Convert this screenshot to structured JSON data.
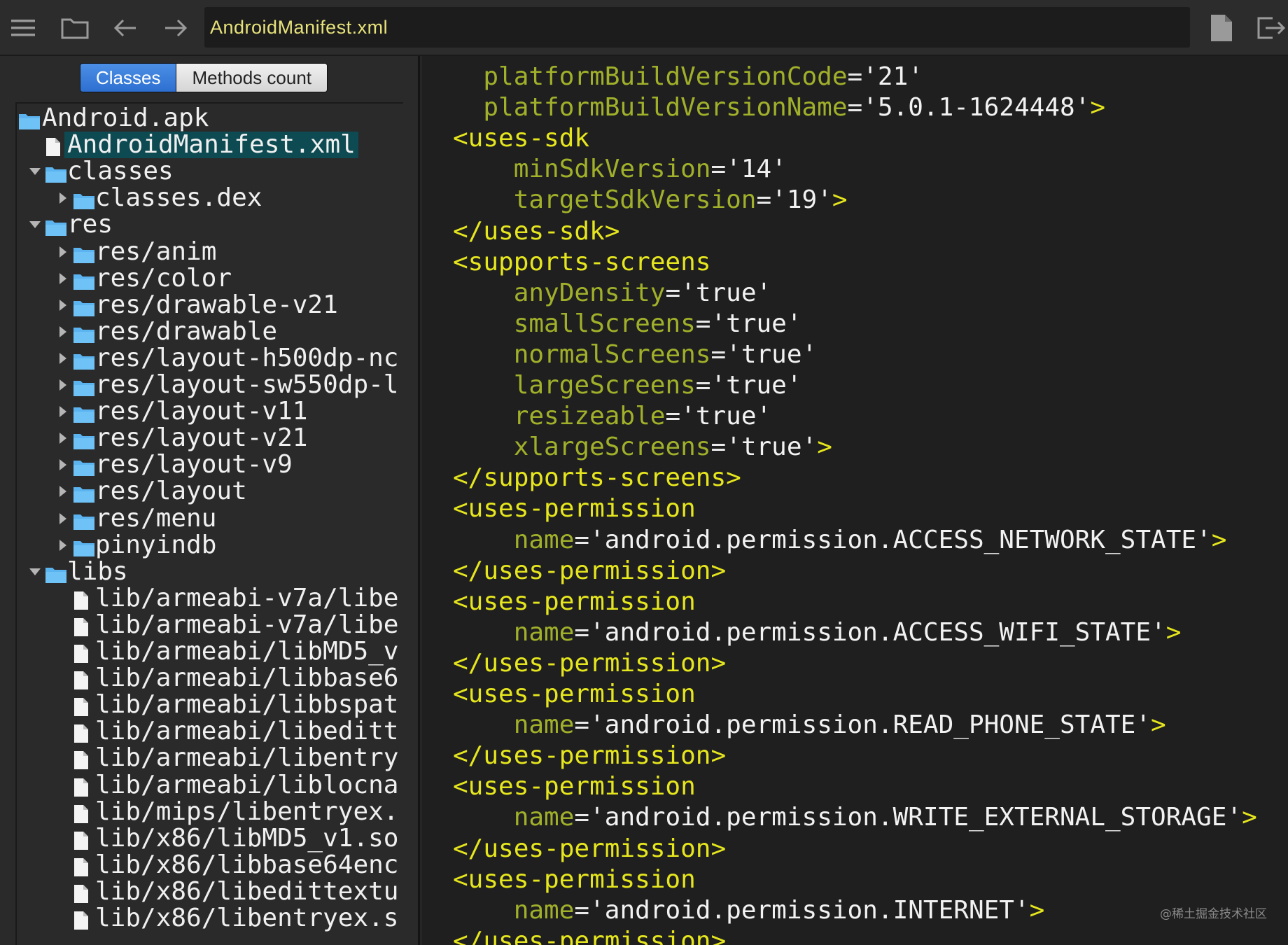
{
  "toolbar": {
    "icons": [
      "menu-icon",
      "folder-icon",
      "back-arrow-icon",
      "forward-arrow-icon",
      "file-icon",
      "exit-icon"
    ],
    "path": "AndroidManifest.xml"
  },
  "tabs": {
    "classes": "Classes",
    "methods_count": "Methods count",
    "selected": "Classes"
  },
  "tree": [
    {
      "label": "Android.apk",
      "type": "folder",
      "depth": 0,
      "expand": "none"
    },
    {
      "label": "AndroidManifest.xml",
      "type": "file",
      "depth": 1,
      "expand": "none",
      "selected": true
    },
    {
      "label": "classes",
      "type": "folder",
      "depth": 1,
      "expand": "open"
    },
    {
      "label": "classes.dex",
      "type": "folder",
      "depth": 2,
      "expand": "closed"
    },
    {
      "label": "res",
      "type": "folder",
      "depth": 1,
      "expand": "open"
    },
    {
      "label": "res/anim",
      "type": "folder",
      "depth": 2,
      "expand": "closed"
    },
    {
      "label": "res/color",
      "type": "folder",
      "depth": 2,
      "expand": "closed"
    },
    {
      "label": "res/drawable-v21",
      "type": "folder",
      "depth": 2,
      "expand": "closed"
    },
    {
      "label": "res/drawable",
      "type": "folder",
      "depth": 2,
      "expand": "closed"
    },
    {
      "label": "res/layout-h500dp-nc",
      "type": "folder",
      "depth": 2,
      "expand": "closed"
    },
    {
      "label": "res/layout-sw550dp-l",
      "type": "folder",
      "depth": 2,
      "expand": "closed"
    },
    {
      "label": "res/layout-v11",
      "type": "folder",
      "depth": 2,
      "expand": "closed"
    },
    {
      "label": "res/layout-v21",
      "type": "folder",
      "depth": 2,
      "expand": "closed"
    },
    {
      "label": "res/layout-v9",
      "type": "folder",
      "depth": 2,
      "expand": "closed"
    },
    {
      "label": "res/layout",
      "type": "folder",
      "depth": 2,
      "expand": "closed"
    },
    {
      "label": "res/menu",
      "type": "folder",
      "depth": 2,
      "expand": "closed"
    },
    {
      "label": "pinyindb",
      "type": "folder",
      "depth": 2,
      "expand": "closed"
    },
    {
      "label": "libs",
      "type": "folder",
      "depth": 1,
      "expand": "open"
    },
    {
      "label": "lib/armeabi-v7a/libe",
      "type": "file",
      "depth": 2,
      "expand": "none"
    },
    {
      "label": "lib/armeabi-v7a/libe",
      "type": "file",
      "depth": 2,
      "expand": "none"
    },
    {
      "label": "lib/armeabi/libMD5_v",
      "type": "file",
      "depth": 2,
      "expand": "none"
    },
    {
      "label": "lib/armeabi/libbase6",
      "type": "file",
      "depth": 2,
      "expand": "none"
    },
    {
      "label": "lib/armeabi/libbspat",
      "type": "file",
      "depth": 2,
      "expand": "none"
    },
    {
      "label": "lib/armeabi/libeditt",
      "type": "file",
      "depth": 2,
      "expand": "none"
    },
    {
      "label": "lib/armeabi/libentry",
      "type": "file",
      "depth": 2,
      "expand": "none"
    },
    {
      "label": "lib/armeabi/liblocna",
      "type": "file",
      "depth": 2,
      "expand": "none"
    },
    {
      "label": "lib/mips/libentryex.",
      "type": "file",
      "depth": 2,
      "expand": "none"
    },
    {
      "label": "lib/x86/libMD5_v1.so",
      "type": "file",
      "depth": 2,
      "expand": "none"
    },
    {
      "label": "lib/x86/libbase64enc",
      "type": "file",
      "depth": 2,
      "expand": "none"
    },
    {
      "label": "lib/x86/libedittextu",
      "type": "file",
      "depth": 2,
      "expand": "none"
    },
    {
      "label": "lib/x86/libentryex.s",
      "type": "file",
      "depth": 2,
      "expand": "none"
    }
  ],
  "code_lines": [
    {
      "indent": "  ",
      "attr": "platformBuildVersionCode",
      "eq": "=",
      "val": "'21'"
    },
    {
      "indent": "  ",
      "attr": "platformBuildVersionName",
      "eq": "=",
      "val": "'5.0.1-1624448'",
      "tag_close": ">"
    },
    {
      "tag": "<uses-sdk"
    },
    {
      "indent": "    ",
      "attr": "minSdkVersion",
      "eq": "=",
      "val": "'14'"
    },
    {
      "indent": "    ",
      "attr": "targetSdkVersion",
      "eq": "=",
      "val": "'19'",
      "tag_close": ">"
    },
    {
      "tag": "</uses-sdk>"
    },
    {
      "tag": "<supports-screens"
    },
    {
      "indent": "    ",
      "attr": "anyDensity",
      "eq": "=",
      "val": "'true'"
    },
    {
      "indent": "    ",
      "attr": "smallScreens",
      "eq": "=",
      "val": "'true'"
    },
    {
      "indent": "    ",
      "attr": "normalScreens",
      "eq": "=",
      "val": "'true'"
    },
    {
      "indent": "    ",
      "attr": "largeScreens",
      "eq": "=",
      "val": "'true'"
    },
    {
      "indent": "    ",
      "attr": "resizeable",
      "eq": "=",
      "val": "'true'"
    },
    {
      "indent": "    ",
      "attr": "xlargeScreens",
      "eq": "=",
      "val": "'true'",
      "tag_close": ">"
    },
    {
      "tag": "</supports-screens>"
    },
    {
      "tag": "<uses-permission"
    },
    {
      "indent": "    ",
      "attr": "name",
      "eq": "=",
      "val": "'android.permission.ACCESS_NETWORK_STATE'",
      "tag_close": ">"
    },
    {
      "tag": "</uses-permission>"
    },
    {
      "tag": "<uses-permission"
    },
    {
      "indent": "    ",
      "attr": "name",
      "eq": "=",
      "val": "'android.permission.ACCESS_WIFI_STATE'",
      "tag_close": ">"
    },
    {
      "tag": "</uses-permission>"
    },
    {
      "tag": "<uses-permission"
    },
    {
      "indent": "    ",
      "attr": "name",
      "eq": "=",
      "val": "'android.permission.READ_PHONE_STATE'",
      "tag_close": ">"
    },
    {
      "tag": "</uses-permission>"
    },
    {
      "tag": "<uses-permission"
    },
    {
      "indent": "    ",
      "attr": "name",
      "eq": "=",
      "val": "'android.permission.WRITE_EXTERNAL_STORAGE'",
      "tag_close": ">"
    },
    {
      "tag": "</uses-permission>"
    },
    {
      "tag": "<uses-permission"
    },
    {
      "indent": "    ",
      "attr": "name",
      "eq": "=",
      "val": "'android.permission.INTERNET'",
      "tag_close": ">"
    },
    {
      "tag": "</uses-permission>"
    }
  ],
  "watermark": "@稀土掘金技术社区",
  "colors": {
    "tag": "#e6e61e",
    "attribute": "#a1b02a",
    "path_text": "#e7e27b",
    "folder": "#5bb3ef",
    "selection": "#0d4a52",
    "tab_active": "#2d6fd0"
  }
}
